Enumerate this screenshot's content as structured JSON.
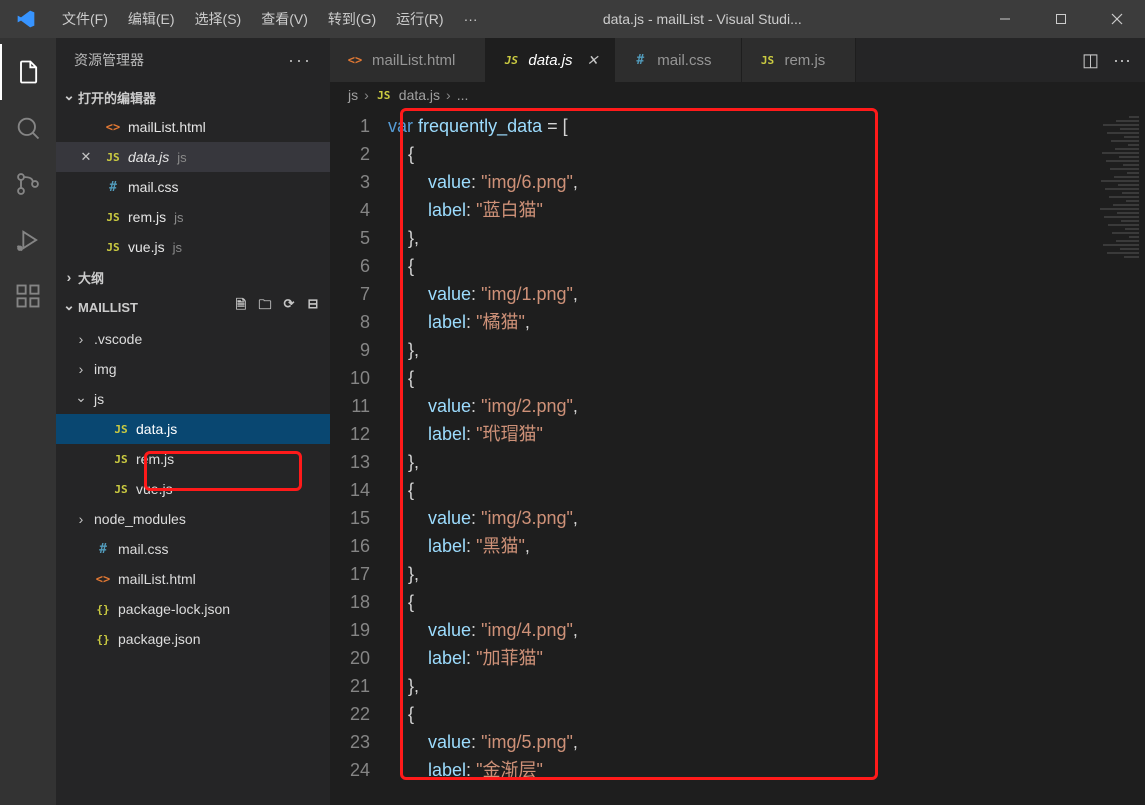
{
  "window": {
    "title": "data.js - mailList - Visual Studi..."
  },
  "menubar": {
    "items": [
      "文件(F)",
      "编辑(E)",
      "选择(S)",
      "查看(V)",
      "转到(G)",
      "运行(R)",
      "···"
    ]
  },
  "sidebar": {
    "title": "资源管理器",
    "sections": {
      "openEditors": {
        "label": "打开的编辑器",
        "items": [
          {
            "icon": "html",
            "label": "mailList.html",
            "desc": "",
            "active": false
          },
          {
            "icon": "js",
            "label": "data.js",
            "desc": "js",
            "active": true
          },
          {
            "icon": "css",
            "label": "mail.css",
            "desc": "",
            "active": false
          },
          {
            "icon": "js",
            "label": "rem.js",
            "desc": "js",
            "active": false
          },
          {
            "icon": "js",
            "label": "vue.js",
            "desc": "js",
            "active": false
          }
        ]
      },
      "outline": {
        "label": "大纲"
      },
      "project": {
        "label": "MAILLIST",
        "tree": [
          {
            "type": "folder",
            "label": ".vscode",
            "expanded": false,
            "depth": 0
          },
          {
            "type": "folder",
            "label": "img",
            "expanded": false,
            "depth": 0
          },
          {
            "type": "folder",
            "label": "js",
            "expanded": true,
            "depth": 0
          },
          {
            "type": "file",
            "icon": "js",
            "label": "data.js",
            "depth": 1,
            "selected": true
          },
          {
            "type": "file",
            "icon": "js",
            "label": "rem.js",
            "depth": 1
          },
          {
            "type": "file",
            "icon": "js",
            "label": "vue.js",
            "depth": 1
          },
          {
            "type": "folder",
            "label": "node_modules",
            "expanded": false,
            "depth": 0
          },
          {
            "type": "file",
            "icon": "css",
            "label": "mail.css",
            "depth": 0
          },
          {
            "type": "file",
            "icon": "html",
            "label": "mailList.html",
            "depth": 0
          },
          {
            "type": "file",
            "icon": "json",
            "label": "package-lock.json",
            "depth": 0
          },
          {
            "type": "file",
            "icon": "json",
            "label": "package.json",
            "depth": 0
          }
        ]
      }
    }
  },
  "tabs": {
    "items": [
      {
        "icon": "html",
        "label": "mailList.html",
        "active": false
      },
      {
        "icon": "js",
        "label": "data.js",
        "active": true
      },
      {
        "icon": "css",
        "label": "mail.css",
        "active": false
      },
      {
        "icon": "js",
        "label": "rem.js",
        "active": false
      }
    ]
  },
  "breadcrumbs": {
    "parts": [
      "js",
      "data.js",
      "..."
    ],
    "icons": [
      "",
      "js",
      ""
    ]
  },
  "code": {
    "lines": [
      [
        [
          "kw",
          "var"
        ],
        [
          "punc",
          " "
        ],
        [
          "id",
          "frequently_data"
        ],
        [
          "punc",
          " = ["
        ]
      ],
      [
        [
          "punc",
          "    {"
        ]
      ],
      [
        [
          "punc",
          "        "
        ],
        [
          "prop",
          "value"
        ],
        [
          "punc",
          ": "
        ],
        [
          "str",
          "\"img/6.png\""
        ],
        [
          "punc",
          ","
        ]
      ],
      [
        [
          "punc",
          "        "
        ],
        [
          "prop",
          "label"
        ],
        [
          "punc",
          ": "
        ],
        [
          "str",
          "\"蓝白猫\""
        ]
      ],
      [
        [
          "punc",
          "    },"
        ]
      ],
      [
        [
          "punc",
          "    {"
        ]
      ],
      [
        [
          "punc",
          "        "
        ],
        [
          "prop",
          "value"
        ],
        [
          "punc",
          ": "
        ],
        [
          "str",
          "\"img/1.png\""
        ],
        [
          "punc",
          ","
        ]
      ],
      [
        [
          "punc",
          "        "
        ],
        [
          "prop",
          "label"
        ],
        [
          "punc",
          ": "
        ],
        [
          "str",
          "\"橘猫\""
        ],
        [
          "punc",
          ","
        ]
      ],
      [
        [
          "punc",
          "    },"
        ]
      ],
      [
        [
          "punc",
          "    {"
        ]
      ],
      [
        [
          "punc",
          "        "
        ],
        [
          "prop",
          "value"
        ],
        [
          "punc",
          ": "
        ],
        [
          "str",
          "\"img/2.png\""
        ],
        [
          "punc",
          ","
        ]
      ],
      [
        [
          "punc",
          "        "
        ],
        [
          "prop",
          "label"
        ],
        [
          "punc",
          ": "
        ],
        [
          "str",
          "\"玳瑁猫\""
        ]
      ],
      [
        [
          "punc",
          "    },"
        ]
      ],
      [
        [
          "punc",
          "    {"
        ]
      ],
      [
        [
          "punc",
          "        "
        ],
        [
          "prop",
          "value"
        ],
        [
          "punc",
          ": "
        ],
        [
          "str",
          "\"img/3.png\""
        ],
        [
          "punc",
          ","
        ]
      ],
      [
        [
          "punc",
          "        "
        ],
        [
          "prop",
          "label"
        ],
        [
          "punc",
          ": "
        ],
        [
          "str",
          "\"黑猫\""
        ],
        [
          "punc",
          ","
        ]
      ],
      [
        [
          "punc",
          "    },"
        ]
      ],
      [
        [
          "punc",
          "    {"
        ]
      ],
      [
        [
          "punc",
          "        "
        ],
        [
          "prop",
          "value"
        ],
        [
          "punc",
          ": "
        ],
        [
          "str",
          "\"img/4.png\""
        ],
        [
          "punc",
          ","
        ]
      ],
      [
        [
          "punc",
          "        "
        ],
        [
          "prop",
          "label"
        ],
        [
          "punc",
          ": "
        ],
        [
          "str",
          "\"加菲猫\""
        ]
      ],
      [
        [
          "punc",
          "    },"
        ]
      ],
      [
        [
          "punc",
          "    {"
        ]
      ],
      [
        [
          "punc",
          "        "
        ],
        [
          "prop",
          "value"
        ],
        [
          "punc",
          ": "
        ],
        [
          "str",
          "\"img/5.png\""
        ],
        [
          "punc",
          ","
        ]
      ],
      [
        [
          "punc",
          "        "
        ],
        [
          "prop",
          "label"
        ],
        [
          "punc",
          ": "
        ],
        [
          "str",
          "\"金渐层\""
        ]
      ]
    ]
  }
}
